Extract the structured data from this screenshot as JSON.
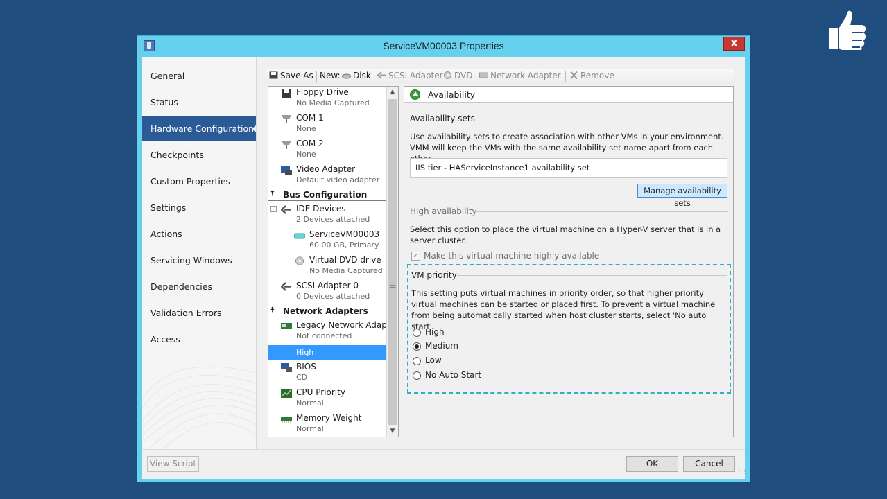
{
  "window": {
    "title": "ServiceVM00003 Properties",
    "close_label": "x"
  },
  "nav": {
    "items": [
      {
        "label": "General"
      },
      {
        "label": "Status"
      },
      {
        "label": "Hardware Configuration"
      },
      {
        "label": "Checkpoints"
      },
      {
        "label": "Custom Properties"
      },
      {
        "label": "Settings"
      },
      {
        "label": "Actions"
      },
      {
        "label": "Servicing Windows"
      },
      {
        "label": "Dependencies"
      },
      {
        "label": "Validation Errors"
      },
      {
        "label": "Access"
      }
    ],
    "active_index": 2
  },
  "toolbar": {
    "save_as": "Save As",
    "new_label": "New:",
    "disk": "Disk",
    "scsi": "SCSI Adapter",
    "dvd": "DVD",
    "network": "Network Adapter",
    "remove": "Remove"
  },
  "tree": {
    "floppy": {
      "name": "Floppy Drive",
      "sub": "No Media Captured"
    },
    "com1": {
      "name": "COM 1",
      "sub": "None"
    },
    "com2": {
      "name": "COM 2",
      "sub": "None"
    },
    "video": {
      "name": "Video Adapter",
      "sub": "Default video adapter"
    },
    "bus_header": "Bus Configuration",
    "ide": {
      "name": "IDE Devices",
      "sub": "2 Devices attached"
    },
    "disk": {
      "name": "ServiceVM00003",
      "sub": "60.00 GB, Primary"
    },
    "dvd": {
      "name": "Virtual DVD drive",
      "sub": "No Media Captured"
    },
    "scsi": {
      "name": "SCSI Adapter 0",
      "sub": "0 Devices attached"
    },
    "net_header": "Network Adapters",
    "legacy": {
      "name": "Legacy Network Adap...",
      "sub": "Not connected"
    },
    "availability": {
      "sub": "High"
    },
    "bios": {
      "name": "BIOS",
      "sub": "CD"
    },
    "cpu": {
      "name": "CPU Priority",
      "sub": "Normal"
    },
    "memory": {
      "name": "Memory Weight",
      "sub": "Normal"
    }
  },
  "panel": {
    "title": "Availability",
    "availability_sets": {
      "heading": "Availability sets",
      "description": "Use availability sets to create association with other VMs in your environment. VMM will keep the VMs with the same availability set name apart from each other.",
      "value": "IIS tier - HAServiceInstance1 availability set",
      "manage_button": "Manage availability sets"
    },
    "high_availability": {
      "heading": "High availability",
      "description": "Select this option to place the virtual machine on a Hyper-V server that is in a server cluster.",
      "checkbox_label": "Make this virtual machine highly available",
      "checked": true
    },
    "vm_priority": {
      "heading": "VM priority",
      "description": "This setting puts virtual machines in priority order, so that higher priority virtual machines can be started or placed first. To prevent a virtual machine from being automatically started when host cluster starts, select 'No auto start'.",
      "options": [
        "High",
        "Medium",
        "Low",
        "No Auto Start"
      ],
      "selected": "Medium"
    }
  },
  "footer": {
    "view_script": "View Script",
    "ok": "OK",
    "cancel": "Cancel"
  }
}
